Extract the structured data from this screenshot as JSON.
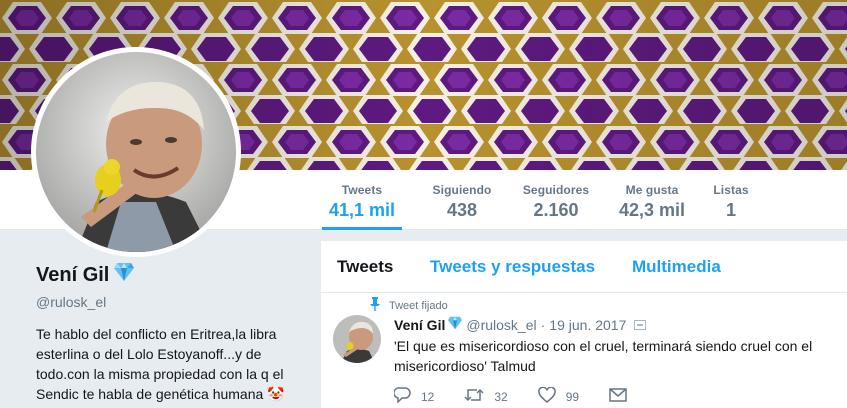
{
  "banner": {
    "colors": {
      "gold": "#b8922e",
      "purple": "#6a1f8c",
      "white": "#f5efe4"
    }
  },
  "profile": {
    "name": "Vení Gil",
    "handle": "@rulosk_el",
    "bio": "Te hablo del conflicto en Eritrea,la libra esterlina o del Lolo Estoyanoff...y de todo.con la misma propiedad con la q el Sendic te habla de genética humana 🤡",
    "verified_icon": "diamond-icon"
  },
  "stats": [
    {
      "label": "Tweets",
      "value": "41,1 mil"
    },
    {
      "label": "Siguiendo",
      "value": "438"
    },
    {
      "label": "Seguidores",
      "value": "2.160"
    },
    {
      "label": "Me gusta",
      "value": "42,3 mil"
    },
    {
      "label": "Listas",
      "value": "1"
    }
  ],
  "tabs": [
    {
      "label": "Tweets"
    },
    {
      "label": "Tweets y respuestas"
    },
    {
      "label": "Multimedia"
    }
  ],
  "tweet": {
    "pinned_label": "Tweet fijado",
    "name": "Vení Gil",
    "handle": "@rulosk_el",
    "separator": "·",
    "date": "19 jun. 2017",
    "text": "'El que es misericordioso con el cruel, terminará siendo cruel con el misericordioso' Talmud",
    "replies": "12",
    "retweets": "32",
    "likes": "99"
  },
  "colors": {
    "accent": "#1da1f2",
    "muted": "#657786",
    "text": "#14171a"
  }
}
